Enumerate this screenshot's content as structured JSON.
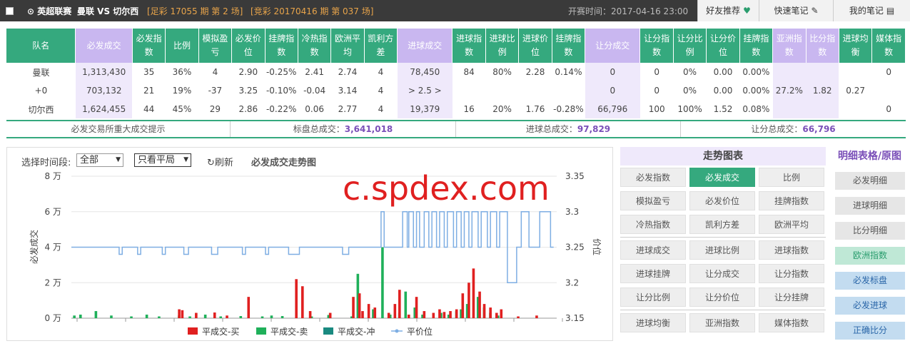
{
  "topbar": {
    "league": "⊙ 英超联赛",
    "teams": "曼联  VS 切尔西",
    "zucai": "[足彩 17055 期 第 2 场]",
    "jingcai": "[竞彩 20170416 期 第 037 场]",
    "kickoff": "开赛时间：2017-04-16 23:00",
    "buttons": [
      "好友推荐",
      "快速笔记",
      "我的笔记"
    ]
  },
  "table": {
    "headers": [
      "队名",
      "必发成交",
      "必发指数",
      "比例",
      "模拟盈亏",
      "必发价位",
      "挂牌指数",
      "冷热指数",
      "欧洲平均",
      "凯利方差",
      "进球成交",
      "进球指数",
      "进球比例",
      "进球价位",
      "挂牌指数",
      "让分成交",
      "让分指数",
      "让分比例",
      "让分价位",
      "挂牌指数",
      "亚洲指数",
      "比分指数",
      "进球均衡",
      "媒体指数"
    ],
    "rows": [
      [
        "曼联",
        "1,313,430",
        "35",
        "36%",
        "4",
        "2.90",
        "-0.25%",
        "2.41",
        "2.74",
        "4",
        "78,450",
        "84",
        "80%",
        "2.28",
        "0.14%",
        "0",
        "0",
        "0%",
        "0.00",
        "0.00%",
        "",
        "",
        "",
        "0"
      ],
      [
        "+0",
        "703,132",
        "21",
        "19%",
        "-37",
        "3.25",
        "-0.10%",
        "-0.04",
        "3.14",
        "4",
        "> 2.5 >",
        "",
        "",
        "",
        "",
        "0",
        "0",
        "0%",
        "0.00",
        "0.00%",
        "27.2%",
        "1.82",
        "0.27",
        ""
      ],
      [
        "切尔西",
        "1,624,455",
        "44",
        "45%",
        "29",
        "2.86",
        "-0.22%",
        "0.06",
        "2.77",
        "4",
        "19,379",
        "16",
        "20%",
        "1.76",
        "-0.28%",
        "66,796",
        "100",
        "100%",
        "1.52",
        "0.08%",
        "",
        "",
        "",
        "0"
      ]
    ]
  },
  "summary": {
    "hint": "必发交易所重大成交提示",
    "pan_label": "标盘总成交：",
    "pan_value": "3,641,018",
    "goal_label": "进球总成交：",
    "goal_value": "97,829",
    "hcp_label": "让分总成交：",
    "hcp_value": "66,796"
  },
  "chart_controls": {
    "time_label": "选择时间段:",
    "time_select": "全部",
    "filter_select": "只看平局",
    "refresh": "刷新",
    "title": "必发成交走势图"
  },
  "watermark": "c.spdex.com",
  "chart_data": {
    "type": "bar",
    "left_axis": {
      "label": "必发成交",
      "ticks": [
        "8 万",
        "6 万",
        "4 万",
        "2 万",
        "0 万"
      ],
      "range": [
        0,
        80000
      ]
    },
    "right_axis": {
      "label": "价位",
      "ticks": [
        "3.35",
        "3.3",
        "3.25",
        "3.2",
        "3.15"
      ],
      "range": [
        3.15,
        3.35
      ]
    },
    "legend": [
      "平成交-买",
      "平成交-卖",
      "平成交-冲",
      "平价位"
    ],
    "colors": {
      "buy": "#e02020",
      "sell": "#1fb05a",
      "flush": "#1a8a80",
      "price": "#7eaee3"
    },
    "buy": [
      [
        70,
        5000
      ],
      [
        72,
        4500
      ],
      [
        81,
        3000
      ],
      [
        93,
        3200
      ],
      [
        101,
        1500
      ],
      [
        115,
        12000
      ],
      [
        146,
        22000
      ],
      [
        150,
        18000
      ],
      [
        155,
        4000
      ],
      [
        168,
        3000
      ],
      [
        183,
        12000
      ],
      [
        187,
        14000
      ],
      [
        189,
        4000
      ],
      [
        193,
        8000
      ],
      [
        197,
        6000
      ],
      [
        206,
        3000
      ],
      [
        210,
        8000
      ],
      [
        213,
        16000
      ],
      [
        219,
        2000
      ],
      [
        224,
        12000
      ],
      [
        229,
        4000
      ],
      [
        235,
        3000
      ],
      [
        239,
        5000
      ],
      [
        242,
        3500
      ],
      [
        246,
        4000
      ],
      [
        250,
        5000
      ],
      [
        254,
        14000
      ],
      [
        258,
        20000
      ],
      [
        261,
        28000
      ],
      [
        265,
        15000
      ],
      [
        268,
        8000
      ],
      [
        272,
        6000
      ],
      [
        276,
        3000
      ],
      [
        279,
        5000
      ],
      [
        290,
        1000
      ],
      [
        302,
        1500
      ]
    ],
    "sell": [
      [
        1,
        1500
      ],
      [
        5,
        2000
      ],
      [
        15,
        4000
      ],
      [
        25,
        1500
      ],
      [
        38,
        1000
      ],
      [
        48,
        2000
      ],
      [
        56,
        1000
      ],
      [
        69,
        1500
      ],
      [
        76,
        1000
      ],
      [
        86,
        2000
      ],
      [
        96,
        1000
      ],
      [
        109,
        1200
      ],
      [
        123,
        1000
      ],
      [
        129,
        1500
      ],
      [
        136,
        1200
      ],
      [
        155,
        1000
      ],
      [
        166,
        1800
      ],
      [
        181,
        1000
      ],
      [
        185,
        25000
      ],
      [
        195,
        5000
      ],
      [
        201,
        40000
      ],
      [
        206,
        2000
      ],
      [
        212,
        3000
      ],
      [
        216,
        15000
      ],
      [
        222,
        6000
      ],
      [
        227,
        2000
      ],
      [
        239,
        3000
      ],
      [
        244,
        2000
      ],
      [
        249,
        4000
      ],
      [
        252,
        5000
      ],
      [
        256,
        8000
      ],
      [
        263,
        12000
      ],
      [
        267,
        6000
      ],
      [
        271,
        3000
      ],
      [
        276,
        1500
      ]
    ],
    "flush": [],
    "price_note": "平价位 line alternates between 3.25, 3.24 and 3.3 over the period",
    "price_segments": [
      [
        0,
        3.25
      ],
      [
        30,
        3.25
      ],
      [
        31,
        3.24
      ],
      [
        33,
        3.25
      ],
      [
        42,
        3.25
      ],
      [
        43,
        3.24
      ],
      [
        45,
        3.25
      ],
      [
        58,
        3.25
      ],
      [
        59,
        3.24
      ],
      [
        61,
        3.25
      ],
      [
        72,
        3.25
      ],
      [
        73,
        3.24
      ],
      [
        76,
        3.25
      ],
      [
        90,
        3.25
      ],
      [
        91,
        3.24
      ],
      [
        95,
        3.25
      ],
      [
        110,
        3.25
      ],
      [
        111,
        3.24
      ],
      [
        113,
        3.25
      ],
      [
        125,
        3.25
      ],
      [
        126,
        3.24
      ],
      [
        128,
        3.25
      ],
      [
        140,
        3.25
      ],
      [
        141,
        3.24
      ],
      [
        148,
        3.25
      ],
      [
        175,
        3.25
      ],
      [
        176,
        3.24
      ],
      [
        180,
        3.25
      ],
      [
        200,
        3.25
      ],
      [
        201,
        3.3
      ],
      [
        203,
        3.25
      ],
      [
        214,
        3.25
      ],
      [
        215,
        3.3
      ],
      [
        218,
        3.25
      ],
      [
        219,
        3.3
      ],
      [
        222,
        3.25
      ],
      [
        224,
        3.3
      ],
      [
        226,
        3.25
      ],
      [
        229,
        3.3
      ],
      [
        232,
        3.25
      ],
      [
        234,
        3.3
      ],
      [
        237,
        3.25
      ],
      [
        239,
        3.3
      ],
      [
        242,
        3.25
      ],
      [
        244,
        3.3
      ],
      [
        248,
        3.25
      ],
      [
        250,
        3.3
      ],
      [
        253,
        3.25
      ],
      [
        255,
        3.3
      ],
      [
        258,
        3.25
      ],
      [
        260,
        3.3
      ],
      [
        264,
        3.25
      ],
      [
        266,
        3.3
      ],
      [
        270,
        3.25
      ],
      [
        272,
        3.3
      ],
      [
        276,
        3.25
      ],
      [
        278,
        3.3
      ],
      [
        282,
        3.3
      ],
      [
        283,
        3.2
      ],
      [
        288,
        3.2
      ],
      [
        289,
        3.25
      ],
      [
        292,
        3.3
      ],
      [
        296,
        3.3
      ],
      [
        297,
        3.25
      ],
      [
        303,
        3.25
      ],
      [
        304,
        3.3
      ],
      [
        310,
        3.3
      ],
      [
        311,
        3.25
      ],
      [
        313,
        3.25
      ]
    ]
  },
  "trend_panel": {
    "title": "走势图表",
    "groups": [
      [
        "必发指数",
        "必发成交",
        "比例",
        "模拟盈亏",
        "必发价位",
        "挂牌指数",
        "冷热指数",
        "凯利方差",
        "欧洲平均"
      ],
      [
        "进球成交",
        "进球比例",
        "进球指数",
        "进球挂牌",
        "让分成交",
        "让分指数",
        "让分比例",
        "让分价位",
        "让分挂牌"
      ],
      [
        "进球均衡",
        "亚洲指数",
        "媒体指数"
      ]
    ],
    "active": "必发成交"
  },
  "side_panel": {
    "title": "明细表格/原图",
    "items": [
      {
        "label": "必发明细",
        "bg": "#e6e6e6",
        "fg": "#555"
      },
      {
        "label": "进球明细",
        "bg": "#e6e6e6",
        "fg": "#555"
      },
      {
        "label": "比分明细",
        "bg": "#e6e6e6",
        "fg": "#555"
      },
      {
        "label": "欧洲指数",
        "bg": "#bfe8d6",
        "fg": "#2a9d6e"
      },
      {
        "label": "必发标盘",
        "bg": "#c3dcf0",
        "fg": "#2a66a8"
      },
      {
        "label": "必发进球",
        "bg": "#c3dcf0",
        "fg": "#2a66a8"
      },
      {
        "label": "正确比分",
        "bg": "#c3dcf0",
        "fg": "#2a66a8"
      }
    ]
  }
}
